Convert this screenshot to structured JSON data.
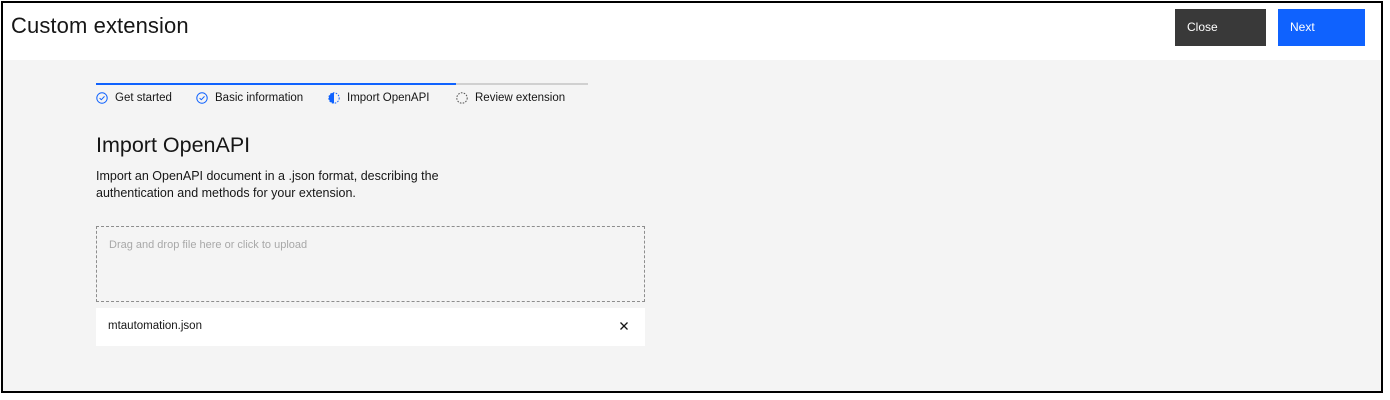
{
  "header": {
    "title": "Custom extension",
    "close_label": "Close",
    "next_label": "Next"
  },
  "progress": {
    "steps": [
      {
        "label": "Get started",
        "state": "complete",
        "icon": "checkmark-outline-icon"
      },
      {
        "label": "Basic information",
        "state": "complete",
        "icon": "checkmark-outline-icon"
      },
      {
        "label": "Import OpenAPI",
        "state": "current",
        "icon": "circle-half-icon"
      },
      {
        "label": "Review extension",
        "state": "incomplete",
        "icon": "circle-dashed-icon"
      }
    ]
  },
  "main": {
    "title": "Import OpenAPI",
    "description": "Import an OpenAPI document in a .json format, describing the authentication and methods for your extension.",
    "dropzone_text": "Drag and drop file here or click to upload",
    "file": {
      "name": "mtautomation.json",
      "remove_icon": "close-icon"
    }
  },
  "colors": {
    "accent": "#0f62fe",
    "close_button": "#393939",
    "background": "#f4f4f4"
  }
}
